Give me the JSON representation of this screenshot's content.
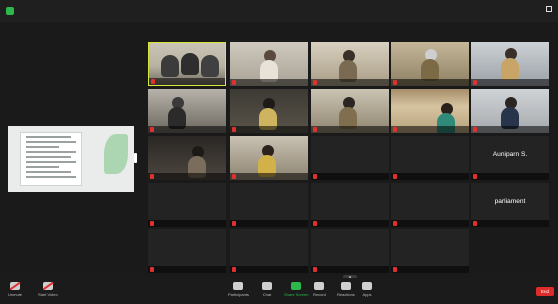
{
  "topbar": {
    "title": "",
    "view_label": ""
  },
  "tiles": [
    {
      "name": "",
      "big": ""
    },
    {
      "name": "",
      "big": ""
    },
    {
      "name": "",
      "big": ""
    },
    {
      "name": "",
      "big": ""
    },
    {
      "name": "",
      "big": ""
    },
    {
      "name": "",
      "big": ""
    },
    {
      "name": "",
      "big": ""
    },
    {
      "name": "",
      "big": ""
    },
    {
      "name": "",
      "big": ""
    },
    {
      "name": "",
      "big": ""
    },
    {
      "name": "",
      "big": ""
    },
    {
      "name": "",
      "big": ""
    },
    {
      "name": "",
      "big": ""
    },
    {
      "name": "",
      "big": ""
    },
    {
      "name": "",
      "big": "Auniparn S."
    },
    {
      "name": "",
      "big": ""
    },
    {
      "name": "",
      "big": ""
    },
    {
      "name": "",
      "big": ""
    },
    {
      "name": "",
      "big": ""
    },
    {
      "name": "",
      "big": "parliament"
    },
    {
      "name": "",
      "big": ""
    },
    {
      "name": "",
      "big": ""
    },
    {
      "name": "",
      "big": ""
    },
    {
      "name": "",
      "big": ""
    }
  ],
  "toolbar": {
    "unmute": "Unmute",
    "start_video": "Start Video",
    "participants": "Participants",
    "chat": "Chat",
    "share_screen": "Share Screen",
    "record": "Record",
    "reactions": "Reactions",
    "apps": "Apps",
    "end": "End"
  },
  "colors": {
    "active_speaker": "#d8e63a",
    "share_green": "#2db84b",
    "end_red": "#e02b2b"
  }
}
